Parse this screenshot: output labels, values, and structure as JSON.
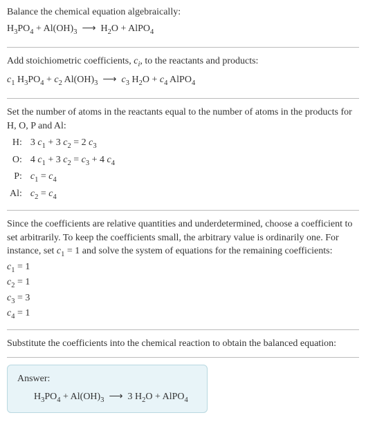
{
  "section1": {
    "heading": "Balance the chemical equation algebraically:",
    "equation_html": "H<sub>3</sub>PO<sub>4</sub> + Al(OH)<sub>3</sub> &nbsp;⟶&nbsp; H<sub>2</sub>O + AlPO<sub>4</sub>"
  },
  "section2": {
    "heading_html": "Add stoichiometric coefficients, <i>c<sub>i</sub></i>, to the reactants and products:",
    "equation_html": "<i>c</i><sub>1</sub> H<sub>3</sub>PO<sub>4</sub> + <i>c</i><sub>2</sub> Al(OH)<sub>3</sub> &nbsp;⟶&nbsp; <i>c</i><sub>3</sub> H<sub>2</sub>O + <i>c</i><sub>4</sub> AlPO<sub>4</sub>"
  },
  "section3": {
    "heading": "Set the number of atoms in the reactants equal to the number of atoms in the products for H, O, P and Al:",
    "rows": [
      {
        "label": "H:",
        "eq_html": "3 <i>c</i><sub>1</sub> + 3 <i>c</i><sub>2</sub> = 2 <i>c</i><sub>3</sub>"
      },
      {
        "label": "O:",
        "eq_html": "4 <i>c</i><sub>1</sub> + 3 <i>c</i><sub>2</sub> = <i>c</i><sub>3</sub> + 4 <i>c</i><sub>4</sub>"
      },
      {
        "label": "P:",
        "eq_html": "<i>c</i><sub>1</sub> = <i>c</i><sub>4</sub>"
      },
      {
        "label": "Al:",
        "eq_html": "<i>c</i><sub>2</sub> = <i>c</i><sub>4</sub>"
      }
    ]
  },
  "section4": {
    "heading_html": "Since the coefficients are relative quantities and underdetermined, choose a coefficient to set arbitrarily. To keep the coefficients small, the arbitrary value is ordinarily one. For instance, set <i>c</i><sub>1</sub> = 1 and solve the system of equations for the remaining coefficients:",
    "lines_html": [
      "<i>c</i><sub>1</sub> = 1",
      "<i>c</i><sub>2</sub> = 1",
      "<i>c</i><sub>3</sub> = 3",
      "<i>c</i><sub>4</sub> = 1"
    ]
  },
  "section5": {
    "heading": "Substitute the coefficients into the chemical reaction to obtain the balanced equation:"
  },
  "answer": {
    "label": "Answer:",
    "equation_html": "H<sub>3</sub>PO<sub>4</sub> + Al(OH)<sub>3</sub> &nbsp;⟶&nbsp; 3 H<sub>2</sub>O + AlPO<sub>4</sub>"
  }
}
